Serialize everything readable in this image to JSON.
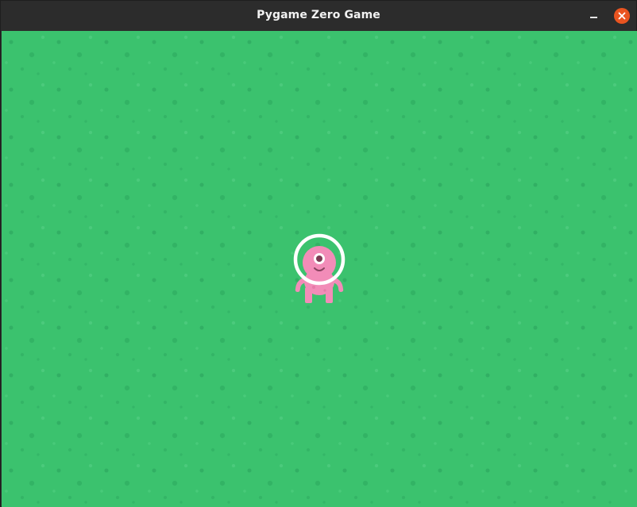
{
  "window": {
    "title": "Pygame Zero Game",
    "controls": {
      "minimize_icon": "minimize-icon",
      "close_icon": "close-icon",
      "close_color": "#e95420"
    }
  },
  "game": {
    "background_color": "#3bc26e",
    "player": {
      "sprite": "pink-one-eyed-alien",
      "body_color": "#f28cb8",
      "has_ring": true,
      "ring_color": "#ffffff"
    }
  }
}
